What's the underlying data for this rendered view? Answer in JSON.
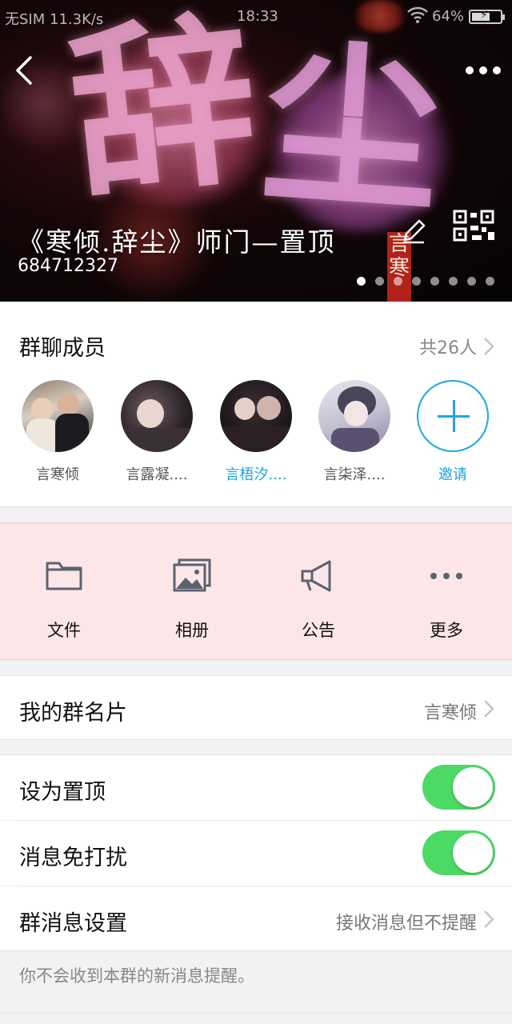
{
  "status_bar": {
    "left": "无SIM 11.3K/s",
    "time": "18:33",
    "battery": "64%",
    "battery_level": 0.64
  },
  "header": {
    "group_name": "《寒倾.辞尘》师门—置顶",
    "group_id": "684712327",
    "banner_chars": [
      "辞",
      "尘"
    ],
    "seal_text": "言寒",
    "page_count": 8,
    "active_page": 1
  },
  "members": {
    "title": "群聊成员",
    "count_label": "共26人",
    "items": [
      {
        "name": "言寒倾",
        "highlight": false
      },
      {
        "name": "言露凝....",
        "highlight": false
      },
      {
        "name": "言梧汐....",
        "highlight": true
      },
      {
        "name": "言柒泽....",
        "highlight": false
      }
    ],
    "invite_label": "邀请"
  },
  "tools": [
    {
      "label": "文件",
      "icon": "folder-icon"
    },
    {
      "label": "相册",
      "icon": "photo-album-icon"
    },
    {
      "label": "公告",
      "icon": "megaphone-icon"
    },
    {
      "label": "更多",
      "icon": "more-dots-icon"
    }
  ],
  "settings": {
    "card": {
      "label": "我的群名片",
      "value": "言寒倾"
    },
    "pin_top": {
      "label": "设为置顶",
      "on": true
    },
    "do_not_disturb": {
      "label": "消息免打扰",
      "on": true
    },
    "message_settings": {
      "label": "群消息设置",
      "value": "接收消息但不提醒"
    },
    "hint": "你不会收到本群的新消息提醒。"
  },
  "colors": {
    "accent_blue": "#1ea8e0",
    "toggle_green": "#4cd964",
    "tools_bg": "#fde6e8",
    "icon_gray": "#5c6270"
  }
}
